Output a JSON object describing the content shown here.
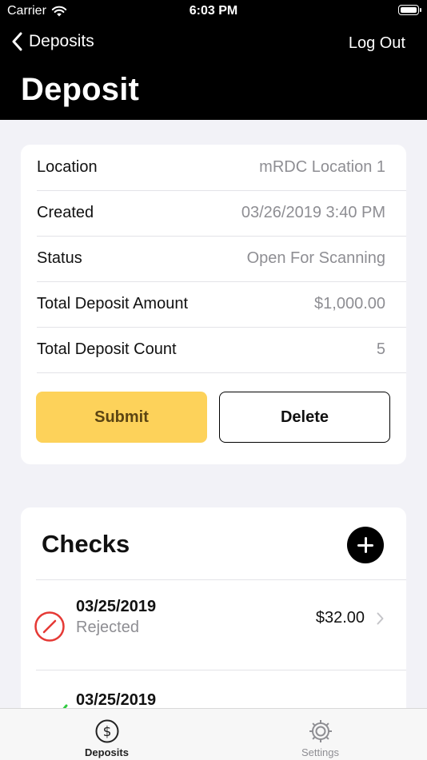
{
  "status_bar": {
    "carrier": "Carrier",
    "time": "6:03 PM"
  },
  "nav": {
    "back_label": "Deposits",
    "logout_label": "Log Out",
    "title": "Deposit"
  },
  "deposit_details": {
    "rows": [
      {
        "label": "Location",
        "value": "mRDC Location 1"
      },
      {
        "label": "Created",
        "value": "03/26/2019 3:40 PM"
      },
      {
        "label": "Status",
        "value": "Open For Scanning"
      },
      {
        "label": "Total Deposit Amount",
        "value": "$1,000.00"
      },
      {
        "label": "Total Deposit Count",
        "value": "5"
      }
    ],
    "submit_label": "Submit",
    "delete_label": "Delete"
  },
  "checks": {
    "title": "Checks",
    "items": [
      {
        "date": "03/25/2019",
        "status": "Rejected",
        "amount": "$32.00",
        "icon": "rejected-icon"
      },
      {
        "date": "03/25/2019",
        "status": "",
        "amount": "",
        "icon": "checkmark-icon"
      }
    ]
  },
  "tabbar": {
    "tabs": [
      {
        "label": "Deposits",
        "icon": "dollar-circle-icon",
        "active": true
      },
      {
        "label": "Settings",
        "icon": "gear-icon",
        "active": false
      }
    ]
  },
  "colors": {
    "accent": "#fdd25a",
    "rejected": "#e53935",
    "success": "#2ecc40",
    "header": "#000000"
  }
}
